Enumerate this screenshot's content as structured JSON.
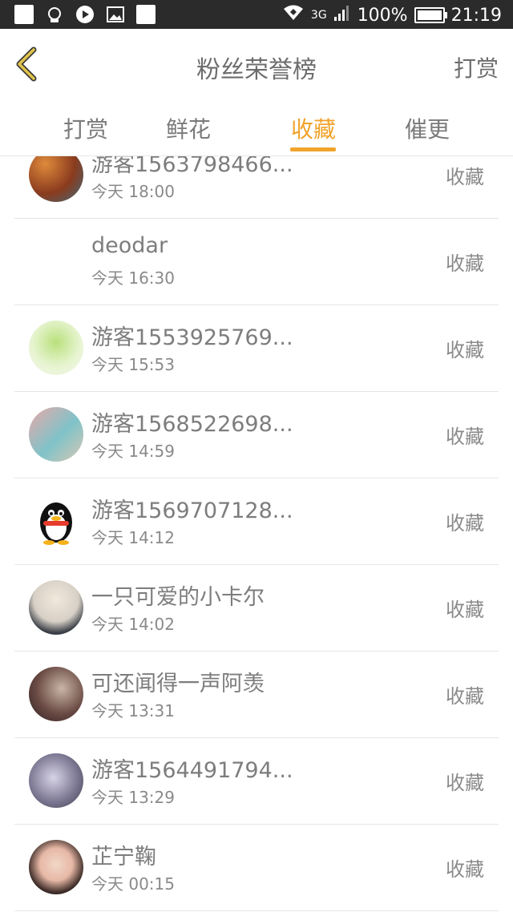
{
  "status_bar": {
    "network": "3G",
    "battery": "100%",
    "time": "21:19"
  },
  "header": {
    "title": "粉丝荣誉榜",
    "action": "打赏"
  },
  "tabs": [
    {
      "label": "打赏"
    },
    {
      "label": "鲜花"
    },
    {
      "label": "收藏"
    },
    {
      "label": "催更"
    }
  ],
  "active_tab": "收藏",
  "colors": {
    "accent": "#f0a32a",
    "text_primary": "#7d7d7d",
    "divider": "#e6e6e6"
  },
  "list": [
    {
      "name": "游客1563798466...",
      "time": "今天 18:00",
      "action": "收藏"
    },
    {
      "name": "deodar",
      "time": "今天 16:30",
      "action": "收藏"
    },
    {
      "name": "游客1553925769...",
      "time": "今天 15:53",
      "action": "收藏"
    },
    {
      "name": "游客1568522698...",
      "time": "今天 14:59",
      "action": "收藏"
    },
    {
      "name": "游客1569707128...",
      "time": "今天 14:12",
      "action": "收藏"
    },
    {
      "name": "一只可爱的小卡尔",
      "time": "今天 14:02",
      "action": "收藏"
    },
    {
      "name": "可还闻得一声阿羡",
      "time": "今天 13:31",
      "action": "收藏"
    },
    {
      "name": "游客1564491794...",
      "time": "今天 13:29",
      "action": "收藏"
    },
    {
      "name": "芷宁鞠",
      "time": "今天 00:15",
      "action": "收藏"
    }
  ]
}
